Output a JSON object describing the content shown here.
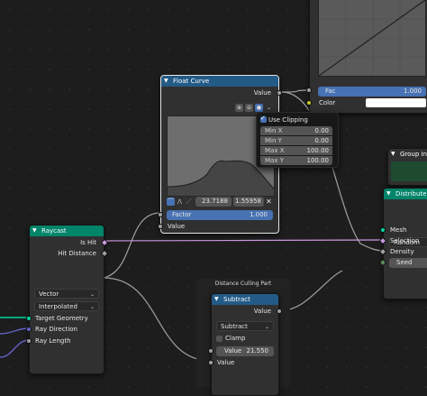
{
  "colors": {
    "background": "#1d1d1d",
    "node_body": "#303030",
    "geometry_header": "#00846a",
    "converter_header": "#235b87",
    "input_header": "#7a2a2a",
    "group_header": "#1e4a30",
    "accent_blue": "#4772b3",
    "float_socket": "#a1a1a1",
    "geometry_socket": "#00d6a3",
    "vector_socket": "#6363c7",
    "bool_socket": "#cc99dd",
    "color_socket": "#c7c729"
  },
  "float_curve": {
    "title": "Float Curve",
    "output_value": "Value",
    "position_x": "23.7188",
    "position_y": "1.55958",
    "factor_label": "Factor",
    "factor_value": "1.000",
    "input_value": "Value"
  },
  "clipping_popup": {
    "use_clipping_label": "Use Clipping",
    "use_clipping_checked": true,
    "rows": [
      {
        "label": "Min X",
        "value": "0.00"
      },
      {
        "label": "Min Y",
        "value": "0.00"
      },
      {
        "label": "Max X",
        "value": "100.00"
      },
      {
        "label": "Max Y",
        "value": "100.00"
      }
    ]
  },
  "color_ramp": {
    "fac_label": "Fac",
    "fac_value": "1.000",
    "color_label": "Color"
  },
  "raycast": {
    "title": "Raycast",
    "is_hit": "Is Hit",
    "hit_distance": "Hit Distance",
    "data_type": "Vector",
    "mapping": "Interpolated",
    "target_geometry": "Target Geometry",
    "ray_direction": "Ray Direction",
    "ray_length": "Ray Length"
  },
  "frame": {
    "label": "Distance Culling Part"
  },
  "subtract": {
    "title": "Subtract",
    "output_value": "Value",
    "operation": "Subtract",
    "clamp_label": "Clamp",
    "clamp_checked": false,
    "value_label": "Value",
    "value_amount": "21.550",
    "input_value": "Value"
  },
  "group_input": {
    "title": "Group Inpu"
  },
  "distribute": {
    "title": "Distribute P",
    "method": "Random",
    "mesh": "Mesh",
    "selection": "Selection",
    "density": "Density",
    "seed": "Seed"
  }
}
